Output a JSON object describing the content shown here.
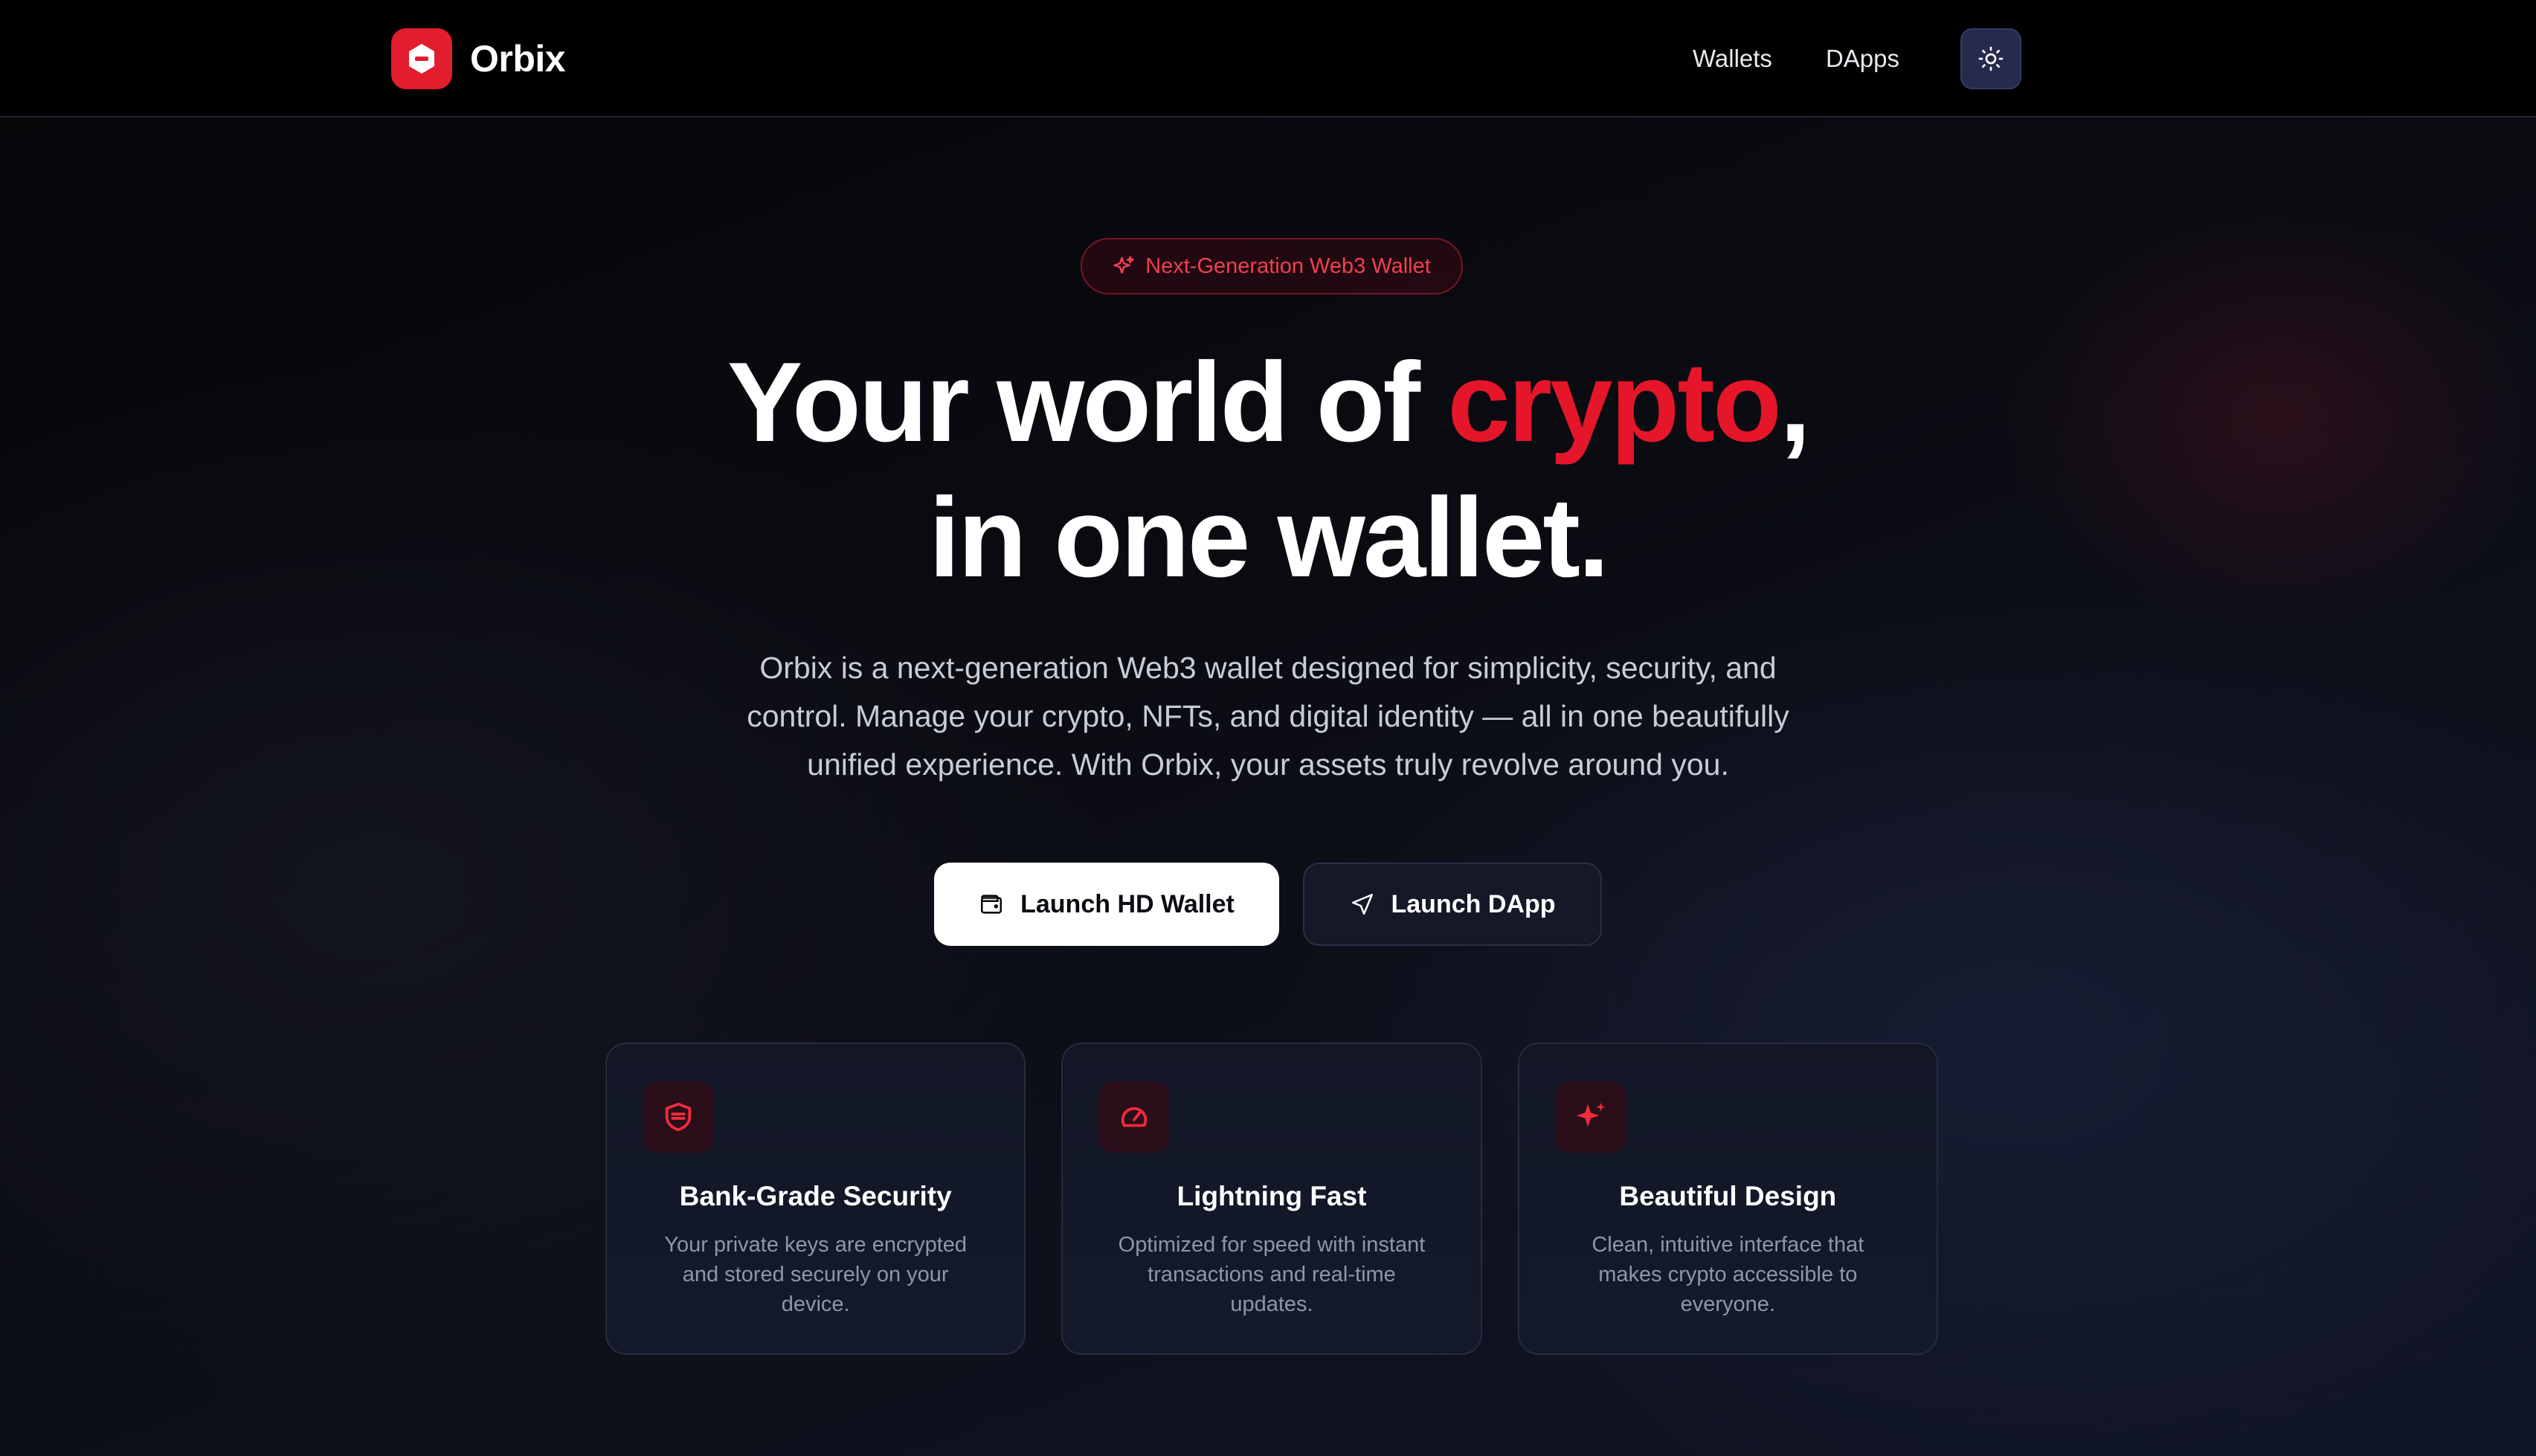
{
  "header": {
    "brand_name": "Orbix",
    "nav": [
      "Wallets",
      "DApps"
    ],
    "theme_toggle_icon": "sun-icon"
  },
  "hero": {
    "badge": "Next-Generation Web3 Wallet",
    "title_part1": "Your world of ",
    "title_accent": "crypto",
    "title_part2": ",",
    "title_line2": "in one wallet.",
    "description": "Orbix is a next-generation Web3 wallet designed for simplicity, security, and control. Manage your crypto, NFTs, and digital identity — all in one beautifully unified experience. With Orbix, your assets truly revolve around you.",
    "primary_cta": "Launch HD Wallet",
    "secondary_cta": "Launch DApp"
  },
  "features": [
    {
      "icon": "shield-icon",
      "title": "Bank-Grade Security",
      "text": "Your private keys are encrypted and stored securely on your device."
    },
    {
      "icon": "gauge-icon",
      "title": "Lightning Fast",
      "text": "Optimized for speed with instant transactions and real-time updates."
    },
    {
      "icon": "sparkles-icon",
      "title": "Beautiful Design",
      "text": "Clean, intuitive interface that makes crypto accessible to everyone."
    }
  ],
  "colors": {
    "accent": "#e5162a",
    "background": "#08090d",
    "card": "#121625",
    "muted_text": "#9096a6"
  }
}
